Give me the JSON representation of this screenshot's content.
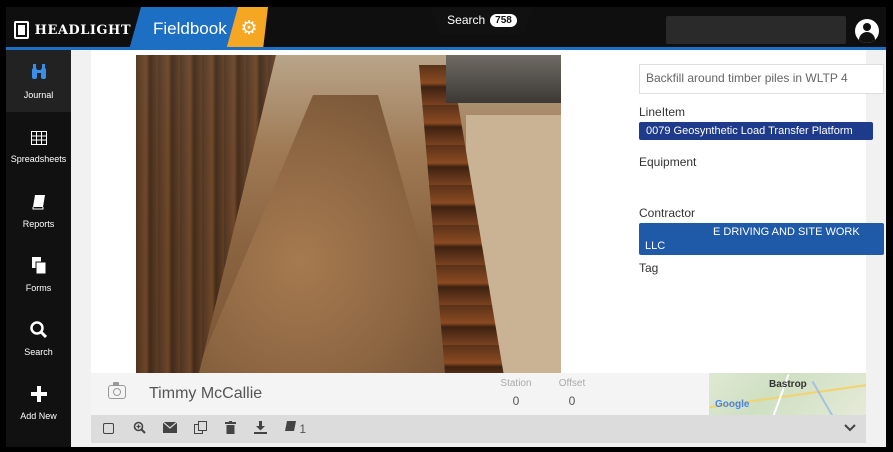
{
  "app": {
    "logo_text": "HEADLIGHT",
    "title": "Fieldbook",
    "gear_icon": "gear-icon",
    "accent_blue": "#1d6fc4",
    "accent_orange": "#f5a623"
  },
  "sidebar": {
    "items": [
      {
        "label": "Journal",
        "icon": "binoculars-icon",
        "glyph": "⛓"
      },
      {
        "label": "Spreadsheets",
        "icon": "grid-icon",
        "glyph": "▦"
      },
      {
        "label": "Reports",
        "icon": "book-icon",
        "glyph": "▰"
      },
      {
        "label": "Forms",
        "icon": "forms-icon",
        "glyph": "▤"
      },
      {
        "label": "Search",
        "icon": "search-icon",
        "glyph": "⌕"
      },
      {
        "label": "Add New",
        "icon": "plus-icon",
        "glyph": "✚"
      }
    ]
  },
  "search_tab": {
    "label": "Search",
    "count": "758"
  },
  "entry": {
    "description": "Backfill around timber piles in WLTP 4",
    "lineitem_label": "LineItem",
    "lineitem_value": "0079 Geosynthetic Load Transfer Platform",
    "equipment_label": "Equipment",
    "contractor_label": "Contractor",
    "contractor_line1": "E DRIVING AND SITE WORK",
    "contractor_line2": "LLC",
    "tag_label": "Tag"
  },
  "footer": {
    "author": "Timmy McCallie",
    "station_label": "Station",
    "station_value": "0",
    "offset_label": "Offset",
    "offset_value": "0",
    "map_town": "Bastrop",
    "map_brand": "Google"
  },
  "actions": {
    "page_count": "1"
  }
}
